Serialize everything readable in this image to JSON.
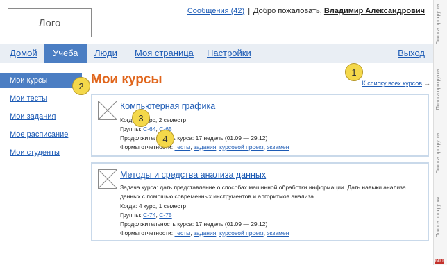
{
  "header": {
    "logo": "Лого",
    "messages_link": "Сообщения (42)",
    "separator": "|",
    "welcome": "Добро пожаловать,",
    "user_name": "Владимир Александрович"
  },
  "nav": {
    "home": "Домой",
    "study": "Учеба",
    "people": "Люди",
    "my_page": "Моя страница",
    "settings": "Настройки",
    "exit": "Выход"
  },
  "sidebar": {
    "items": [
      "Мои курсы",
      "Мои тесты",
      "Мои задания",
      "Мое расписание",
      "Мои студенты"
    ]
  },
  "page": {
    "title": "Мои курсы",
    "back_link": "К списку всех курсов",
    "back_arrow": "→"
  },
  "courses": [
    {
      "title": "Компьютерная графика",
      "when_label": "Когда:",
      "when": "4 курс, 2 семестр",
      "groups_label": "Группы:",
      "groups": [
        "С-64",
        "С-65"
      ],
      "duration_label": "Продолжительность курса:",
      "duration": "17 недель (01.09 — 29.12)",
      "forms_label": "Формы отчетности:",
      "forms": [
        "тесты",
        "задания",
        "курсовой проект",
        "экзамен"
      ]
    },
    {
      "title": "Методы и средства анализа данных",
      "desc": "Задача курса: дать представление о способах машинной обработки информации. Дать навыки анализа данных с помощью современных инструментов и алгоритмов анализа.",
      "when_label": "Когда:",
      "when": "4 курс, 1 семестр",
      "groups_label": "Группы:",
      "groups": [
        "С-74",
        "С-75"
      ],
      "duration_label": "Продолжительность курса:",
      "duration": "17 недель (01.09 — 29.12)",
      "forms_label": "Формы отчетности:",
      "forms": [
        "тесты",
        "задания",
        "курсовой проект",
        "экзамен"
      ]
    }
  ],
  "callouts": [
    "1",
    "2",
    "3",
    "4"
  ],
  "ruler": {
    "label": "Полоса прокрутки",
    "width_number": "600"
  }
}
